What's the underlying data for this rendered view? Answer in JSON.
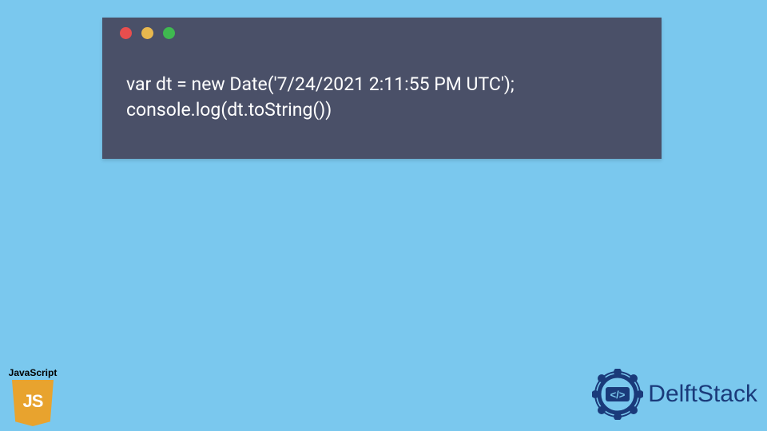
{
  "code": {
    "line1": "var dt = new Date('7/24/2021 2:11:55 PM UTC');",
    "line2": "console.log(dt.toString())"
  },
  "badges": {
    "js_label": "JavaScript",
    "js_shield_text": "JS",
    "delft_text": "DelftStack"
  },
  "colors": {
    "background": "#7ac8ee",
    "window": "#4a5068",
    "js_shield": "#e8a32e",
    "delft_brand": "#1a3a7a"
  }
}
